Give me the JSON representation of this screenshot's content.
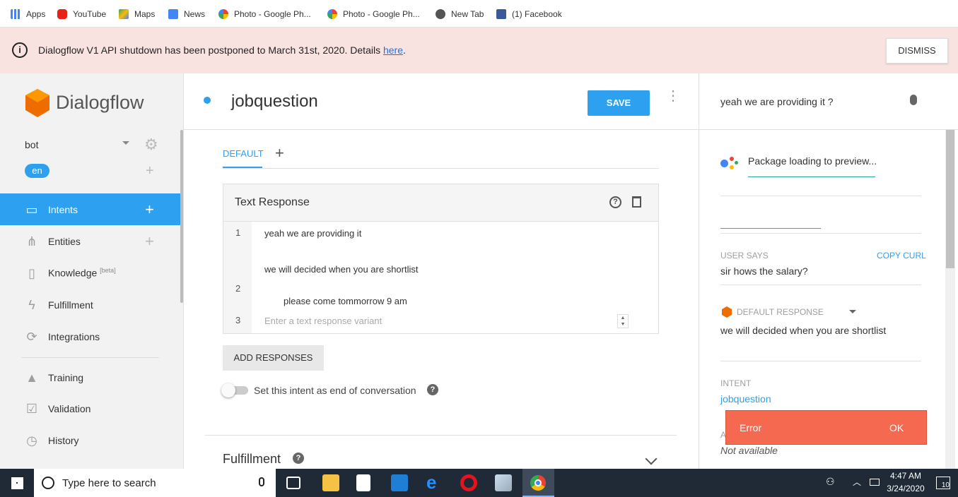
{
  "bookmarks": [
    {
      "label": "Apps",
      "icon": "apps-grid-icon"
    },
    {
      "label": "YouTube",
      "icon": "youtube-icon"
    },
    {
      "label": "Maps",
      "icon": "maps-icon"
    },
    {
      "label": "News",
      "icon": "news-icon"
    },
    {
      "label": "Photo - Google Ph...",
      "icon": "google-photos-icon"
    },
    {
      "label": "Photo - Google Ph...",
      "icon": "google-photos-icon"
    },
    {
      "label": "New Tab",
      "icon": "globe-icon"
    },
    {
      "label": "(1) Facebook",
      "icon": "facebook-icon"
    }
  ],
  "banner": {
    "message": "Dialogflow V1 API shutdown has been postponed to March 31st, 2020. Details",
    "link": "here",
    "dismiss": "DISMISS"
  },
  "sidebar": {
    "logo_text": "Dialogflow",
    "agent": "bot",
    "language": "en",
    "items": [
      {
        "label": "Intents",
        "icon": "chat-bubble-icon",
        "active": true
      },
      {
        "label": "Entities",
        "icon": "hierarchy-icon"
      },
      {
        "label": "Knowledge",
        "icon": "book-icon",
        "badge": "[beta]"
      },
      {
        "label": "Fulfillment",
        "icon": "lightning-icon"
      },
      {
        "label": "Integrations",
        "icon": "sync-icon"
      },
      {
        "label": "Training",
        "icon": "graduation-cap-icon"
      },
      {
        "label": "Validation",
        "icon": "check-box-icon"
      },
      {
        "label": "History",
        "icon": "clock-icon"
      }
    ]
  },
  "intent": {
    "name": "jobquestion",
    "save": "SAVE",
    "tab": "DEFAULT",
    "card_title": "Text Response",
    "rows": [
      {
        "num": "1",
        "text": "yeah we are providing it"
      },
      {
        "num": "2",
        "text": "we will decided when you are shortlist",
        "text2": "please come tommorrow 9 am"
      },
      {
        "num": "3",
        "placeholder": "Enter a text response variant"
      }
    ],
    "add_responses": "ADD RESPONSES",
    "end_conversation": "Set this intent as end of conversation",
    "fulfillment": "Fulfillment"
  },
  "preview": {
    "query": "yeah we are providing it  ?",
    "loading": "Package loading to preview...",
    "user_says_label": "USER SAYS",
    "copy_curl": "COPY CURL",
    "user_says": "sir hows the salary?",
    "default_response_label": "DEFAULT RESPONSE",
    "default_response": "we will decided when you are shortlist",
    "intent_label": "INTENT",
    "intent_value": "jobquestion",
    "action_label": "A",
    "not_available": "Not available"
  },
  "toast": {
    "message": "Error",
    "action": "OK"
  },
  "taskbar": {
    "search_placeholder": "Type here to search",
    "time": "4:47 AM",
    "date": "3/24/2020",
    "notifications": "10"
  },
  "colors": {
    "accent": "#2da0ef",
    "toast": "#f4694f",
    "banner": "#f9e3e1",
    "taskbar": "#1f2a36"
  }
}
